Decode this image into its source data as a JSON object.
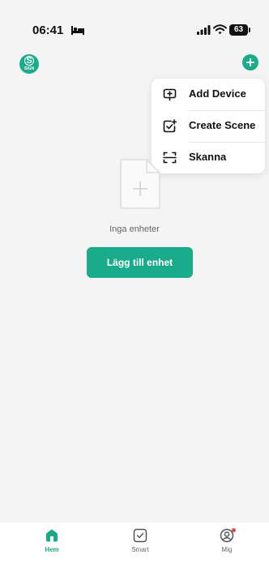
{
  "status_bar": {
    "time": "06:41",
    "battery_level": "63"
  },
  "header": {
    "logo_letter": "S",
    "logo_text": "SIGN"
  },
  "add_menu": {
    "items": [
      {
        "label": "Add Device",
        "icon": "device-plus-icon"
      },
      {
        "label": "Create Scene",
        "icon": "create-scene-icon"
      },
      {
        "label": "Skanna",
        "icon": "scan-icon"
      }
    ]
  },
  "empty_state": {
    "message": "Inga enheter",
    "button_label": "Lägg till enhet"
  },
  "bottom_nav": {
    "items": [
      {
        "label": "Hem",
        "icon": "home-icon",
        "active": true
      },
      {
        "label": "Smart",
        "icon": "smart-check-icon",
        "active": false
      },
      {
        "label": "Mig",
        "icon": "profile-icon",
        "active": false,
        "badge": true
      }
    ]
  },
  "colors": {
    "accent": "#1aab8a",
    "background": "#f4f4f5",
    "badge": "#e8453c"
  }
}
